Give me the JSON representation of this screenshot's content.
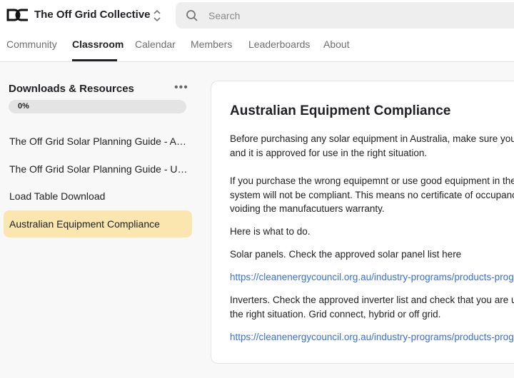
{
  "app": {
    "name": "The Off Grid Collective",
    "logo_icon": "dc-logo-icon",
    "switch_icon": "chevron-up-down-icon"
  },
  "search": {
    "placeholder": "Search",
    "icon": "search-icon"
  },
  "tabs": [
    {
      "label": "Community",
      "active": false
    },
    {
      "label": "Classroom",
      "active": true
    },
    {
      "label": "Calendar",
      "active": false
    },
    {
      "label": "Members",
      "active": false
    },
    {
      "label": "Leaderboards",
      "active": false
    },
    {
      "label": "About",
      "active": false
    }
  ],
  "sidebar": {
    "title": "Downloads & Resources",
    "more_icon": "more-horizontal-icon",
    "progress": {
      "label": "0%",
      "value": 0
    },
    "items": [
      {
        "label": "The Off Grid Solar Planning Guide - Australia",
        "active": false
      },
      {
        "label": "The Off Grid Solar Planning Guide - USA",
        "active": false
      },
      {
        "label": "Load Table Download",
        "active": false
      },
      {
        "label": "Australian Equipment Compliance",
        "active": true
      }
    ]
  },
  "content": {
    "title": "Australian Equipment Compliance",
    "paragraphs": [
      {
        "lines": [
          "Before purchasing any solar equipment in Australia, make sure you have checked that",
          "and it is approved for use in the right situation."
        ]
      },
      {
        "lines": [
          "If you purchase the wrong equipemnt or use good equipment in the wrong situation, your",
          "system will not be compliant. This means no certificate of occupancy and potentially",
          "voiding the manufacutuers warranty."
        ]
      },
      {
        "lines": [
          "Here is what to do."
        ]
      },
      {
        "lines": [
          "Solar panels. Check the approved solar panel list here"
        ]
      },
      {
        "link": "https://cleanenergycouncil.org.au/industry-programs/products-program/modules"
      },
      {
        "lines": [
          "Inverters. Check the approved inverter list and check that you are using the inverter in",
          "the right situation. Grid connect, hybrid or off grid."
        ]
      },
      {
        "link": "https://cleanenergycouncil.org.au/industry-programs/products-program/inverters"
      }
    ]
  },
  "colors": {
    "accent": "#fbe6b0",
    "link": "#3a6fd6",
    "progress_fill": "#f3dd9b"
  }
}
